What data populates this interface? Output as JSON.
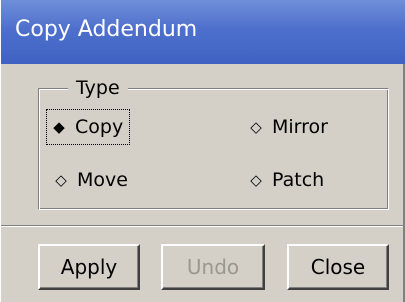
{
  "window": {
    "title": "Copy Addendum"
  },
  "type_group": {
    "legend": "Type",
    "options": [
      {
        "label": "Copy",
        "selected": true,
        "icon": "diamond-filled"
      },
      {
        "label": "Mirror",
        "selected": false,
        "icon": "diamond-outline"
      },
      {
        "label": "Move",
        "selected": false,
        "icon": "diamond-outline"
      },
      {
        "label": "Patch",
        "selected": false,
        "icon": "diamond-outline"
      }
    ],
    "marks": {
      "selected": "◆",
      "unselected": "◇"
    }
  },
  "buttons": {
    "apply": "Apply",
    "undo": "Undo",
    "close": "Close"
  },
  "colors": {
    "titlebar": "#4e70cc",
    "face": "#d4d0c8",
    "disabled_text": "#9a978f"
  }
}
